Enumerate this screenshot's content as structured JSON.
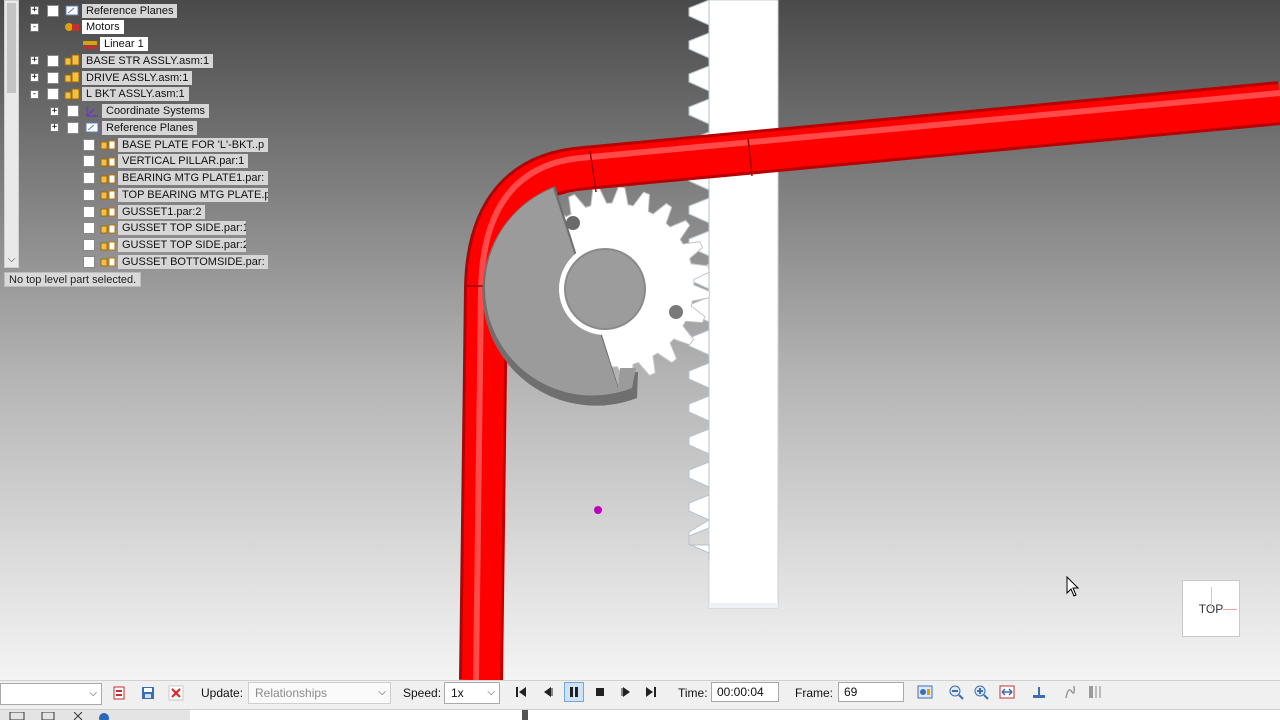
{
  "tree": {
    "items": [
      {
        "label": "Reference Planes",
        "expander": "+",
        "checkbox": true,
        "icon": "reference-planes-icon"
      },
      {
        "label": "Motors",
        "expander": "-",
        "checkbox": false,
        "icon": "motors-icon"
      },
      {
        "label": "Linear 1",
        "expander": "",
        "checkbox": false,
        "icon": "linear-motor-icon"
      },
      {
        "label": "BASE STR ASSLY.asm:1",
        "expander": "+",
        "checkbox": true,
        "icon": "assembly-icon"
      },
      {
        "label": "DRIVE ASSLY.asm:1",
        "expander": "+",
        "checkbox": true,
        "icon": "assembly-icon"
      },
      {
        "label": "L BKT ASSLY.asm:1",
        "expander": "-",
        "checkbox": true,
        "icon": "assembly-icon"
      },
      {
        "label": "Coordinate Systems",
        "expander": "+",
        "checkbox": true,
        "icon": "coordinate-systems-icon"
      },
      {
        "label": "Reference Planes",
        "expander": "+",
        "checkbox": true,
        "icon": "reference-planes-icon"
      },
      {
        "label": "BASE PLATE FOR 'L'-BKT..p",
        "expander": "",
        "checkbox": true,
        "icon": "part-icon"
      },
      {
        "label": "VERTICAL PILLAR.par:1",
        "expander": "",
        "checkbox": true,
        "icon": "part-icon"
      },
      {
        "label": "BEARING MTG PLATE1.par:",
        "expander": "",
        "checkbox": true,
        "icon": "part-icon"
      },
      {
        "label": "TOP BEARING MTG PLATE.p",
        "expander": "",
        "checkbox": true,
        "icon": "part-icon"
      },
      {
        "label": "GUSSET1.par:2",
        "expander": "",
        "checkbox": true,
        "icon": "part-icon"
      },
      {
        "label": "GUSSET TOP SIDE.par:1",
        "expander": "",
        "checkbox": true,
        "icon": "part-icon"
      },
      {
        "label": "GUSSET TOP SIDE.par:2",
        "expander": "",
        "checkbox": true,
        "icon": "part-icon"
      },
      {
        "label": "GUSSET BOTTOMSIDE.par:",
        "expander": "",
        "checkbox": true,
        "icon": "part-icon"
      }
    ],
    "status": "No top level part selected."
  },
  "viewcube": {
    "label": "TOP"
  },
  "toolbar": {
    "update_label": "Update:",
    "update_value": "Relationships",
    "speed_label": "Speed:",
    "speed_value": "1x",
    "time_label": "Time:",
    "time_value": "00:00:04",
    "frame_label": "Frame:",
    "frame_value": "69"
  },
  "colors": {
    "tube": "#ff0000",
    "gear": "#9a9a9a",
    "rack": "#ffffff",
    "marker": "#c000c0"
  }
}
